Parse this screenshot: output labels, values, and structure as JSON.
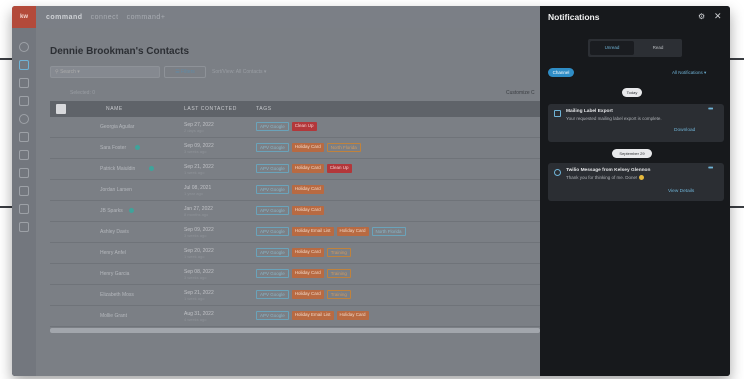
{
  "app": {
    "logo": "kw",
    "nav": [
      "command",
      "connect",
      "command+"
    ]
  },
  "main": {
    "title": "Dennie Brookman's Contacts",
    "search_placeholder": "Search",
    "filters_label": "Filters",
    "sort_label": "Sort/View: All Contacts",
    "selected_count": "Selected: 0",
    "customize_label": "Customize C",
    "columns": [
      "NAME",
      "LAST CONTACTED",
      "TAGS"
    ],
    "rows": [
      {
        "name": "Georgia Aguilar",
        "date": "Sep 27, 2022",
        "ago": "2 days ago",
        "tags": [
          {
            "t": "APV Google",
            "c": "g"
          },
          {
            "t": "Clean Up",
            "c": "r"
          }
        ]
      },
      {
        "name": "Sara Foster",
        "date": "Sep 09, 2022",
        "ago": "3 weeks ago",
        "tags": [
          {
            "t": "APV Google",
            "c": "g"
          },
          {
            "t": "Holiday Card",
            "c": "o"
          },
          {
            "t": "North Florida",
            "c": "h"
          }
        ]
      },
      {
        "name": "Patrick Maiuldin",
        "date": "Sep 21, 2022",
        "ago": "1 week ago",
        "tags": [
          {
            "t": "APV Google",
            "c": "g"
          },
          {
            "t": "Holiday Card",
            "c": "o"
          },
          {
            "t": "Clean Up",
            "c": "r"
          }
        ]
      },
      {
        "name": "Jordan Larsen",
        "date": "Jul 08, 2021",
        "ago": "1 year ago",
        "tags": [
          {
            "t": "APV Google",
            "c": "g"
          },
          {
            "t": "Holiday Card",
            "c": "o"
          }
        ]
      },
      {
        "name": "JB Sparks",
        "date": "Jan 27, 2022",
        "ago": "8 months ago",
        "tags": [
          {
            "t": "APV Google",
            "c": "g"
          },
          {
            "t": "Holiday Card",
            "c": "o"
          }
        ]
      },
      {
        "name": "Ashley Davis",
        "date": "Sep 09, 2022",
        "ago": "3 weeks ago",
        "tags": [
          {
            "t": "APV Google",
            "c": "g"
          },
          {
            "t": "Holiday Email List",
            "c": "o"
          },
          {
            "t": "Holiday Card",
            "c": "o"
          },
          {
            "t": "North Florida",
            "c": "g"
          }
        ]
      },
      {
        "name": "Henry Anfel",
        "date": "Sep 20, 2022",
        "ago": "1 week ago",
        "tags": [
          {
            "t": "APV Google",
            "c": "g"
          },
          {
            "t": "Holiday Card",
            "c": "o"
          },
          {
            "t": "Training",
            "c": "h"
          }
        ]
      },
      {
        "name": "Henry Garcia",
        "date": "Sep 08, 2022",
        "ago": "3 weeks ago",
        "tags": [
          {
            "t": "APV Google",
            "c": "g"
          },
          {
            "t": "Holiday Card",
            "c": "o"
          },
          {
            "t": "Training",
            "c": "h"
          }
        ]
      },
      {
        "name": "Elizabeth Moss",
        "date": "Sep 21, 2022",
        "ago": "1 week ago",
        "tags": [
          {
            "t": "APV Google",
            "c": "g"
          },
          {
            "t": "Holiday Card",
            "c": "o"
          },
          {
            "t": "Training",
            "c": "h"
          }
        ]
      },
      {
        "name": "Mollie Grant",
        "date": "Aug 31, 2022",
        "ago": "4 weeks ago",
        "tags": [
          {
            "t": "APV Google",
            "c": "g"
          },
          {
            "t": "Holiday Email List",
            "c": "o"
          },
          {
            "t": "Holiday Card",
            "c": "o"
          }
        ]
      }
    ]
  },
  "notifications": {
    "title": "Notifications",
    "tabs": {
      "unread": "Unread",
      "read": "Read"
    },
    "channel": "Channel",
    "all_link": "All Notifications",
    "today": "Today",
    "card1": {
      "title": "Mailing Label Export",
      "body": "Your requested mailing label export is complete.",
      "link": "Download"
    },
    "date_sep": "September 29",
    "card2": {
      "title": "Twilio Message from Kelsey Glennon",
      "body": "Thank you for thinking of me. Done!",
      "link": "View Details"
    }
  }
}
